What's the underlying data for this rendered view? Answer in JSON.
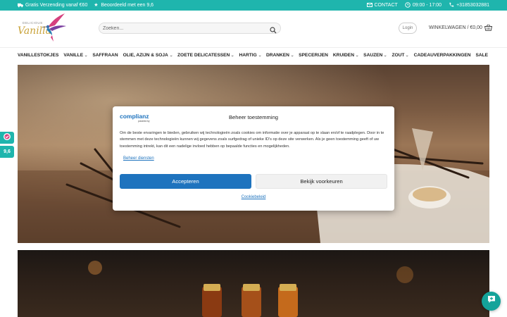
{
  "topbar": {
    "free_shipping": "Gratis Verzending vanaf €60",
    "rating": "Beoordeeld met een 9,6",
    "contact": "CONTACT",
    "hours": "09:00 - 17:00",
    "phone": "+31853032881"
  },
  "header": {
    "logo_small": "DELICIOUS",
    "logo_main": "Vanilla",
    "search_placeholder": "Zoeken...",
    "login_label": "Login",
    "cart_label": "WINKELWAGEN / €0,00"
  },
  "nav": {
    "items": [
      {
        "label": "VANILLESTOKJES",
        "has_dropdown": false
      },
      {
        "label": "VANILLE",
        "has_dropdown": true
      },
      {
        "label": "SAFFRAAN",
        "has_dropdown": false
      },
      {
        "label": "OLIE, AZIJN & SOJA",
        "has_dropdown": true
      },
      {
        "label": "ZOETE DELICATESSEN",
        "has_dropdown": true
      },
      {
        "label": "HARTIG",
        "has_dropdown": true
      },
      {
        "label": "DRANKEN",
        "has_dropdown": true
      },
      {
        "label": "SPECERIJEN",
        "has_dropdown": false
      },
      {
        "label": "KRUIDEN",
        "has_dropdown": true
      },
      {
        "label": "SAUZEN",
        "has_dropdown": true
      },
      {
        "label": "ZOUT",
        "has_dropdown": true
      },
      {
        "label": "CADEAUVERPAKKINGEN",
        "has_dropdown": false
      },
      {
        "label": "SALE",
        "has_dropdown": false
      }
    ]
  },
  "consent": {
    "brand_name": "complianz",
    "brand_sub": "powered by",
    "title": "Beheer toestemming",
    "body": "Om de beste ervaringen te bieden, gebruiken wij technologieën zoals cookies om informatie over je apparaat op te slaan en/of te raadplegen. Door in te stemmen met deze technologieën kunnen wij gegevens zoals surfgedrag of unieke ID's op deze site verwerken. Als je geen toestemming geeft of uw toestemming intrekt, kan dit een nadelige invloed hebben op bepaalde functies en mogelijkheden.",
    "manage_link": "Beheer diensten",
    "accept_label": "Accepteren",
    "preferences_label": "Bekijk voorkeuren",
    "policy_link": "Cookiebeleid"
  },
  "side": {
    "score": "9,6"
  },
  "colors": {
    "teal": "#1fb5ad",
    "accept_blue": "#1e73be",
    "logo_pink": "#d6417e"
  }
}
